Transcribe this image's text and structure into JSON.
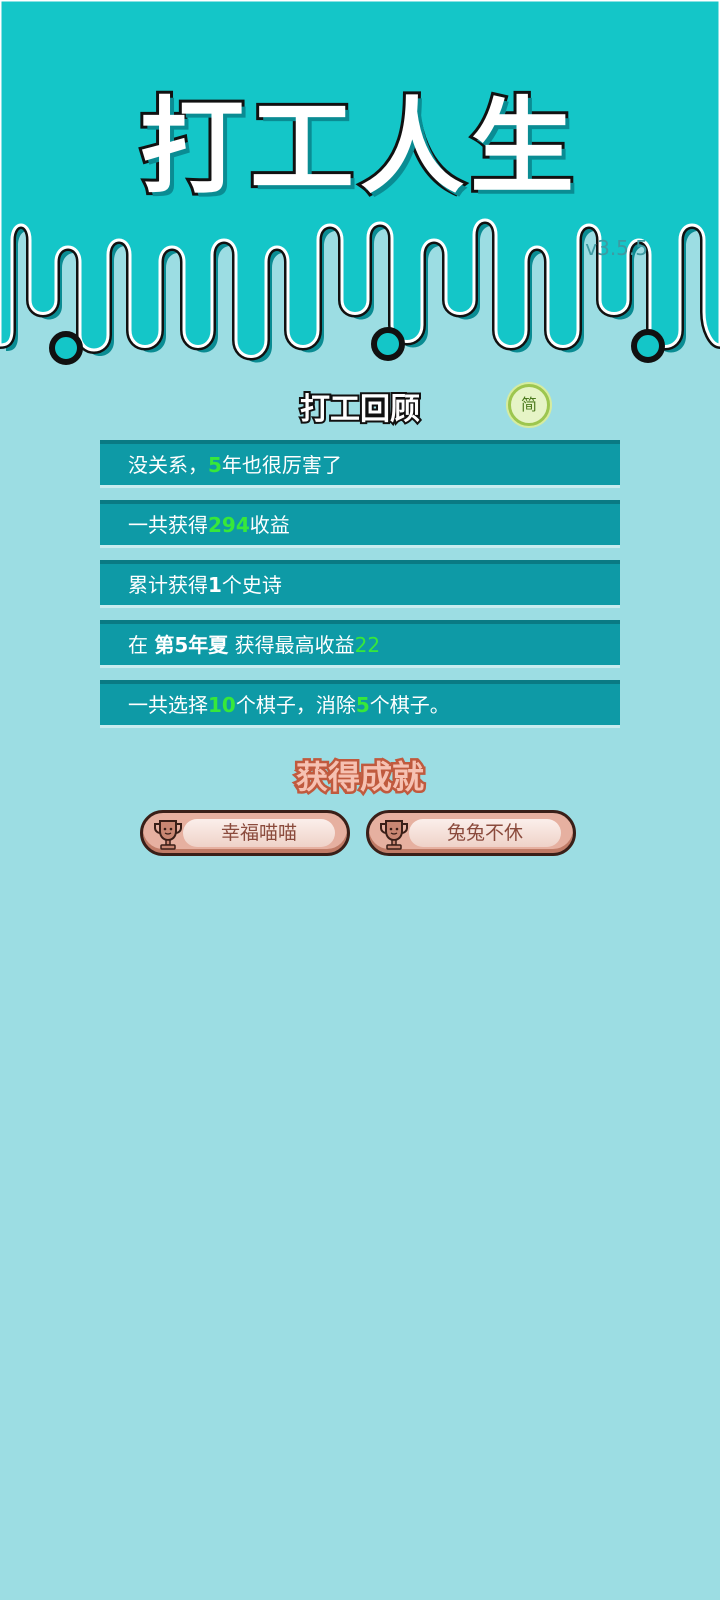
{
  "header": {
    "title": "打工人生",
    "version": "v3.5.5"
  },
  "review": {
    "title": "打工回顾",
    "lang_toggle": "简",
    "rows": [
      {
        "parts": [
          "没关系，",
          "5",
          "年也很厉害了"
        ]
      },
      {
        "parts": [
          "一共获得",
          "294",
          "收益"
        ]
      },
      {
        "parts": [
          "累计获得",
          "1",
          "个史诗"
        ]
      },
      {
        "parts": [
          "在 ",
          "第5年夏",
          " 获得最高收益",
          "22"
        ]
      },
      {
        "parts": [
          "一共选择",
          "10",
          "个棋子，消除",
          "5",
          "个棋子。"
        ]
      }
    ]
  },
  "achievements": {
    "title": "获得成就",
    "items": [
      {
        "label": "幸福喵喵",
        "icon": "trophy-icon"
      },
      {
        "label": "兔兔不休",
        "icon": "trophy-icon"
      }
    ]
  },
  "colors": {
    "header_bg": "#14c6c8",
    "page_bg": "#9cdde3",
    "row_bg": "#0e9aa6",
    "highlight": "#37e83a"
  }
}
